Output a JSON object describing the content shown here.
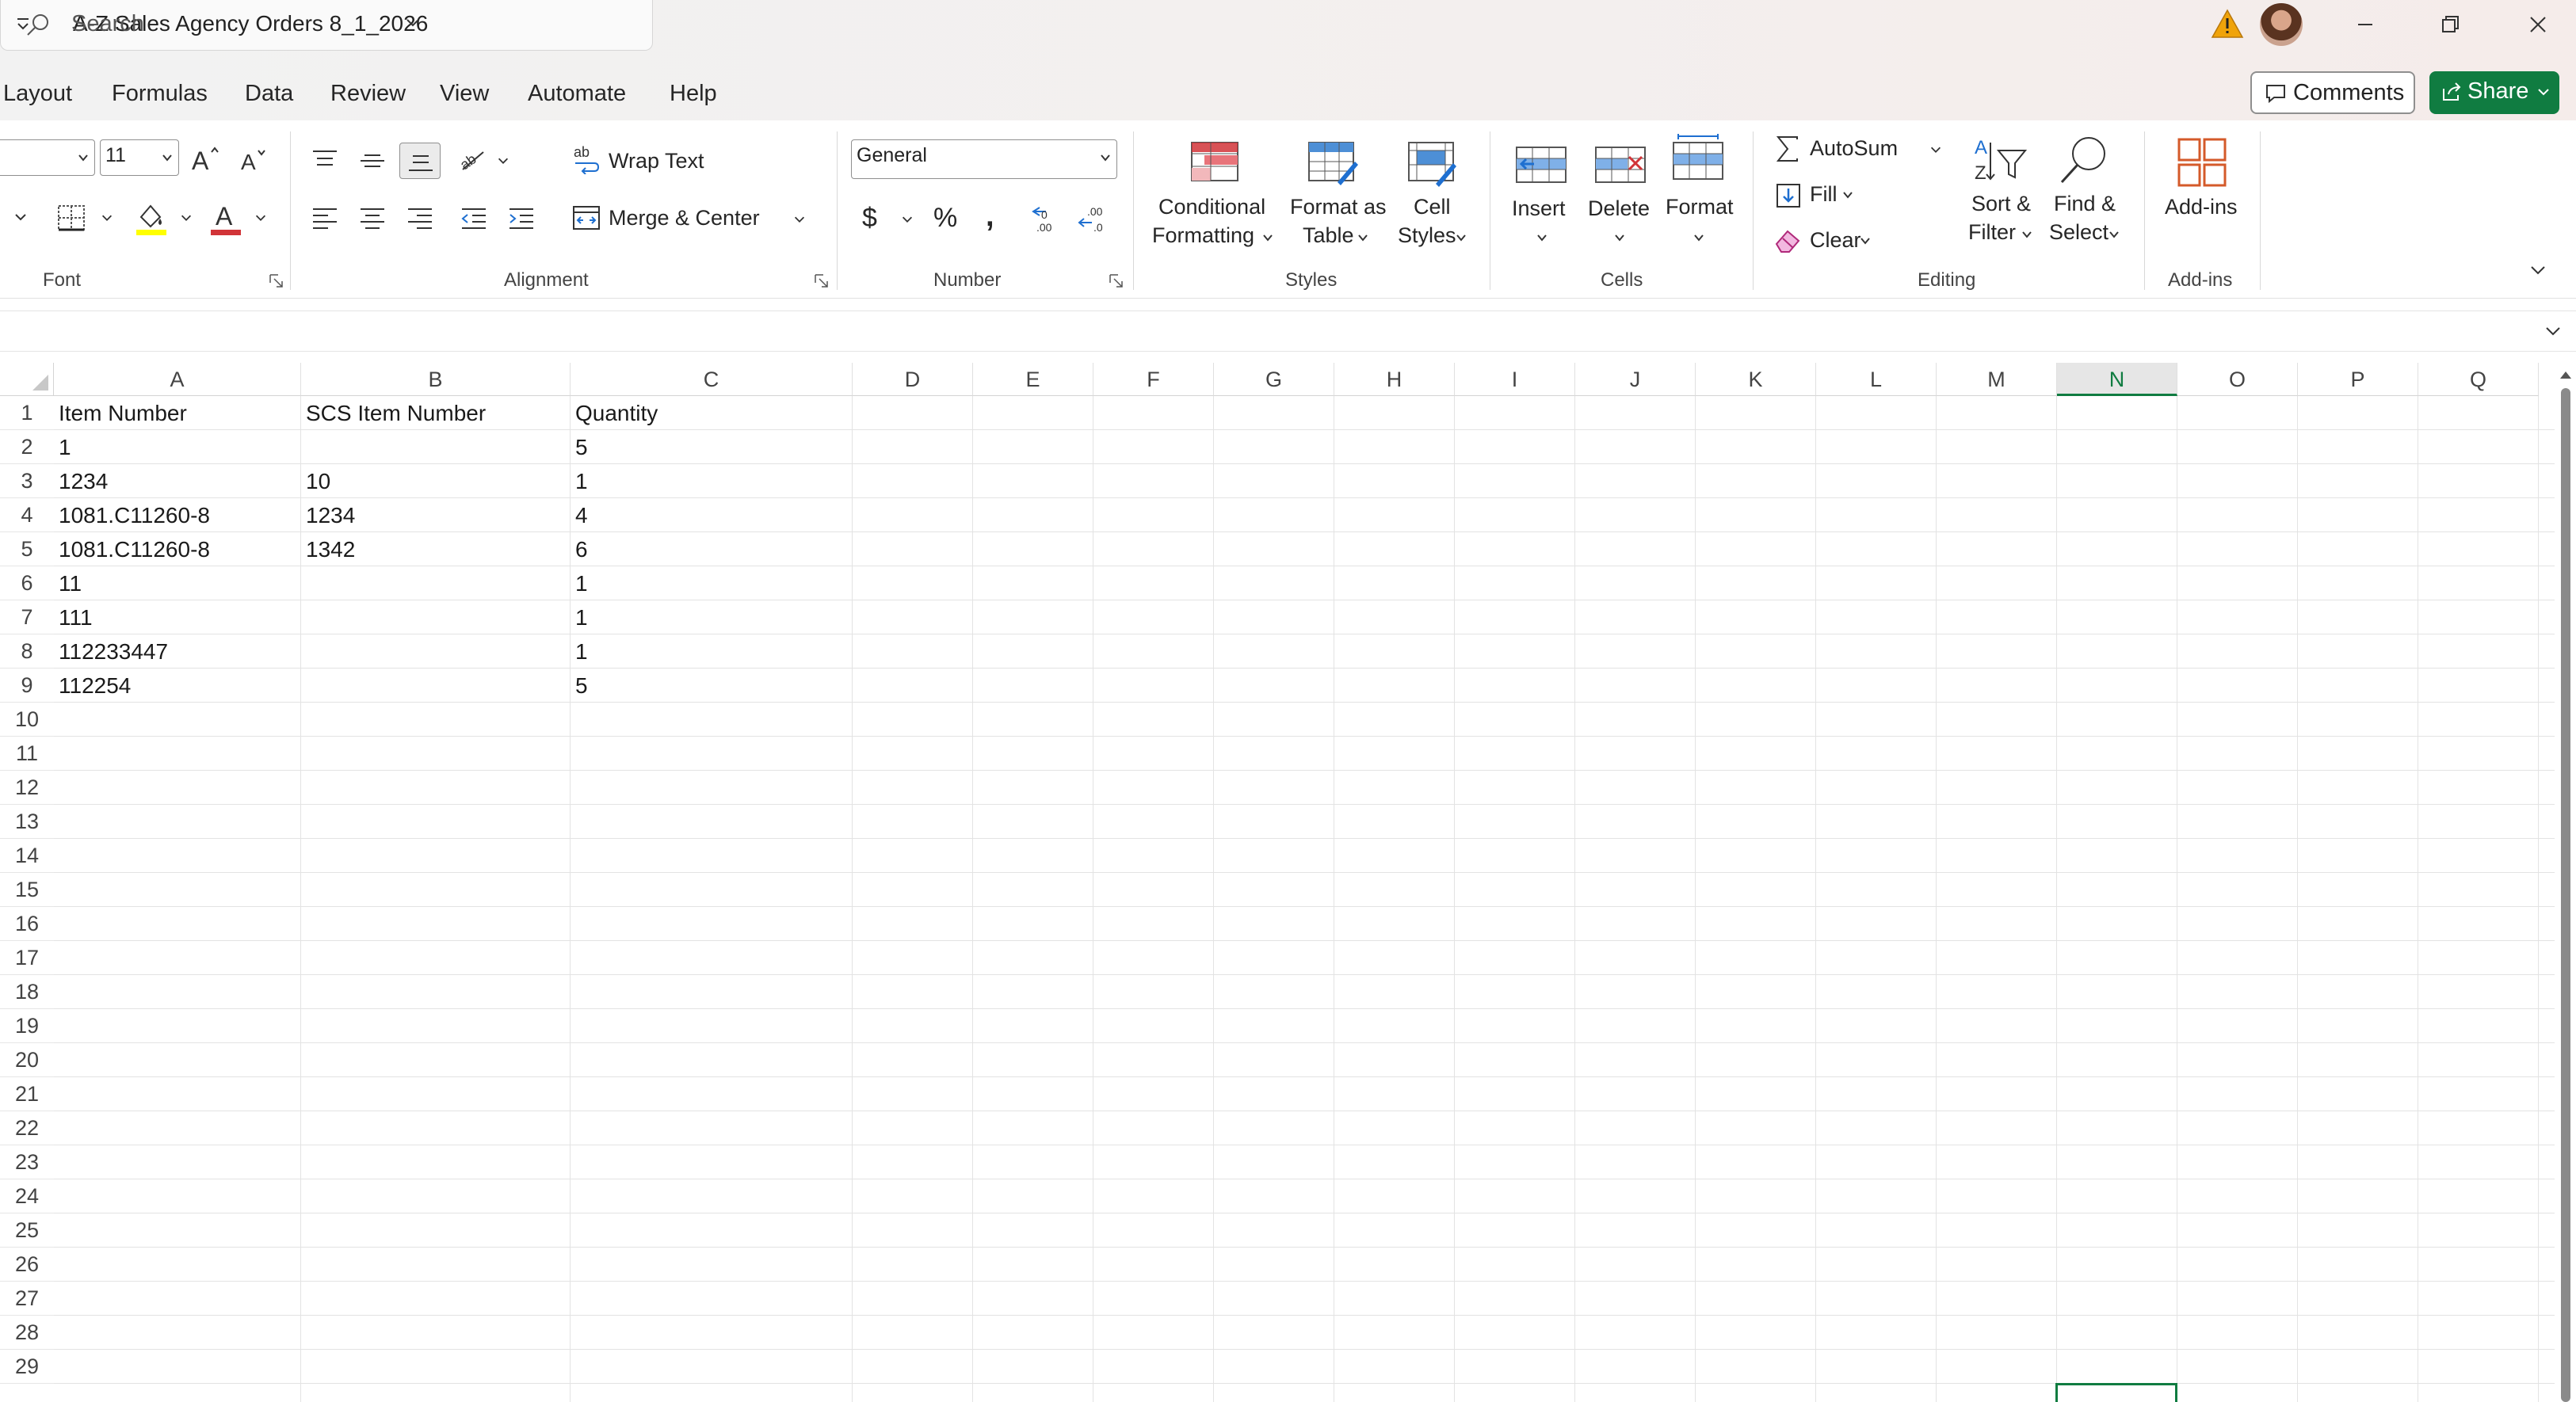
{
  "titlebar": {
    "doc_title": "A-Z Sales Agency Orders 8_1_2026",
    "search_placeholder": "Search"
  },
  "menu": {
    "tabs": [
      "Layout",
      "Formulas",
      "Data",
      "Review",
      "View",
      "Automate",
      "Help"
    ],
    "comments_label": "Comments",
    "share_label": "Share"
  },
  "ribbon": {
    "font": {
      "size": "11",
      "group_label": "Font"
    },
    "alignment": {
      "wrap_text": "Wrap Text",
      "merge_center": "Merge & Center",
      "group_label": "Alignment"
    },
    "number": {
      "format": "General",
      "group_label": "Number"
    },
    "styles": {
      "conditional_formatting": [
        "Conditional",
        "Formatting"
      ],
      "format_as_table": [
        "Format as",
        "Table"
      ],
      "cell_styles": [
        "Cell",
        "Styles"
      ],
      "group_label": "Styles"
    },
    "cells": {
      "insert": "Insert",
      "delete": "Delete",
      "format": "Format",
      "group_label": "Cells"
    },
    "editing": {
      "autosum": "AutoSum",
      "fill": "Fill",
      "clear": "Clear",
      "sort_filter": [
        "Sort &",
        "Filter"
      ],
      "find_select": [
        "Find &",
        "Select"
      ],
      "group_label": "Editing"
    },
    "addins": {
      "label": "Add-ins",
      "group_label": "Add-ins"
    }
  },
  "sheet": {
    "columns": [
      "A",
      "B",
      "C",
      "D",
      "E",
      "F",
      "G",
      "H",
      "I",
      "J",
      "K",
      "L",
      "M",
      "N",
      "O",
      "P",
      "Q"
    ],
    "selected_column": "N",
    "rows": [
      "1",
      "2",
      "3",
      "4",
      "5",
      "6",
      "7",
      "8",
      "9",
      "10",
      "11",
      "12",
      "13",
      "14",
      "15",
      "16",
      "17",
      "18",
      "19",
      "20",
      "21",
      "22",
      "23",
      "24",
      "25",
      "26",
      "27",
      "28",
      "29"
    ],
    "cells": [
      [
        "Item Number",
        "SCS Item Number",
        "Quantity"
      ],
      [
        "1",
        "",
        "5"
      ],
      [
        "1234",
        "10",
        "1"
      ],
      [
        "1081.C11260-8",
        "1234",
        "4"
      ],
      [
        "1081.C11260-8",
        "1342",
        "6"
      ],
      [
        "11",
        "",
        "1"
      ],
      [
        "111",
        "",
        "1"
      ],
      [
        "112233447",
        "",
        "1"
      ],
      [
        "112254",
        "",
        "5"
      ]
    ]
  },
  "colors": {
    "accent": "#107c41",
    "warning": "#f0a30a",
    "font_red": "#d13438",
    "highlight_yellow": "#ffff00"
  }
}
